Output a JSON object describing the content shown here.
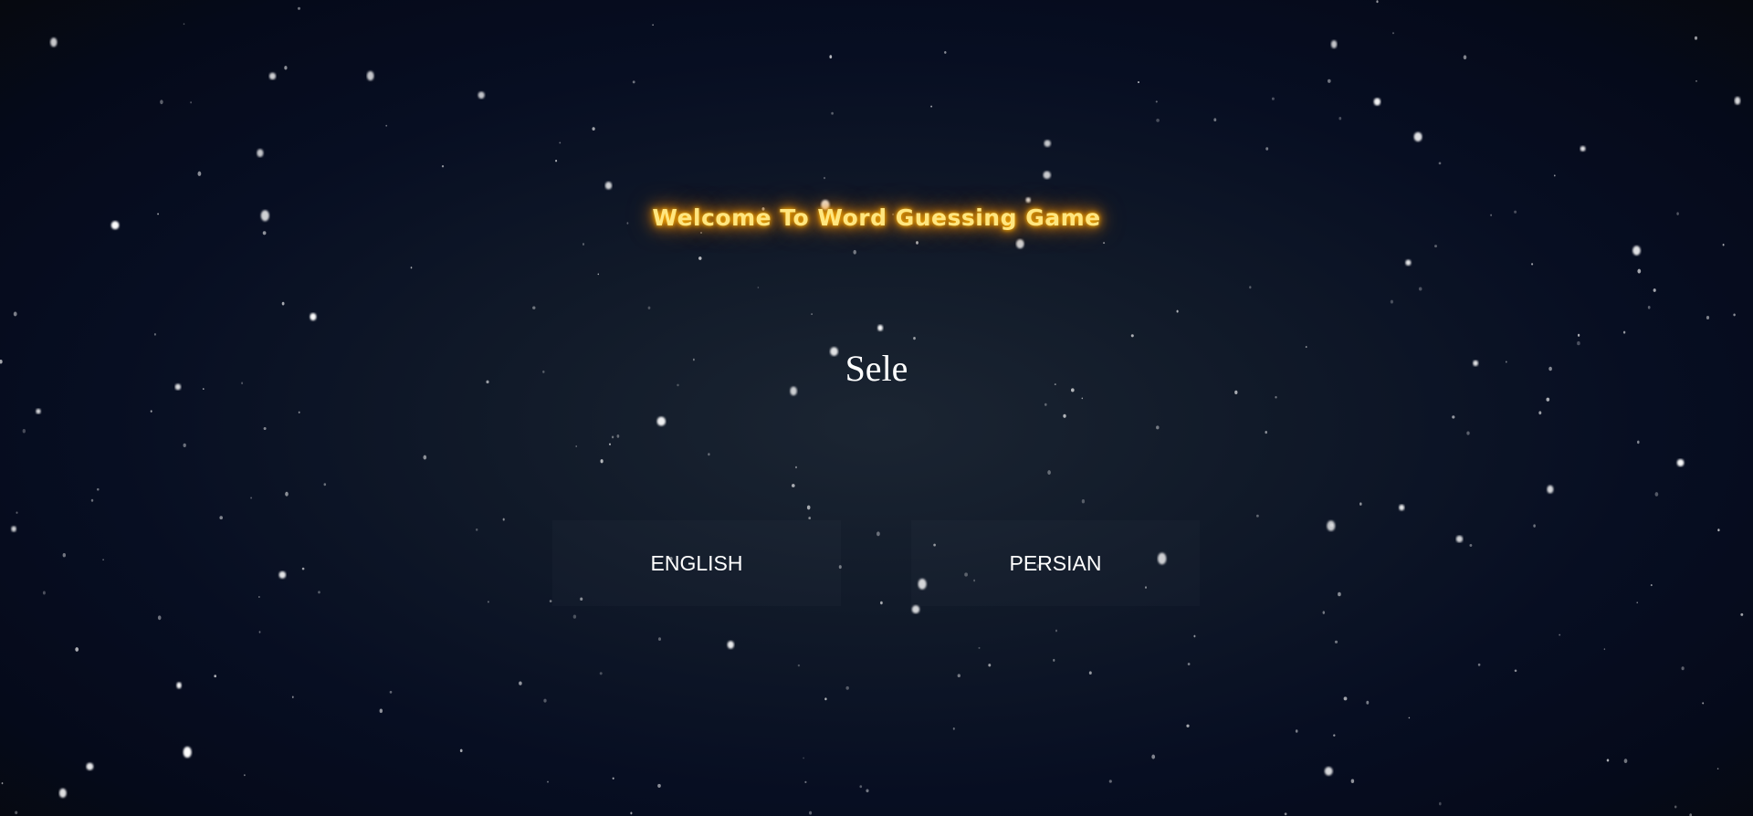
{
  "game": {
    "title": "Welcome To Word Guessing Game",
    "prompt": "Sele",
    "buttons": {
      "english": "ENGLISH",
      "persian": "PERSIAN"
    }
  },
  "colors": {
    "title_text": "#ffe680",
    "title_glow": "#ff9f00",
    "prompt_text": "#ffffff",
    "button_text": "#ffffff",
    "background_center": "#1b2532",
    "background_edge": "#050a1a",
    "snow": "#ffffff"
  },
  "icons": {
    "background": "snowfall-particles"
  }
}
